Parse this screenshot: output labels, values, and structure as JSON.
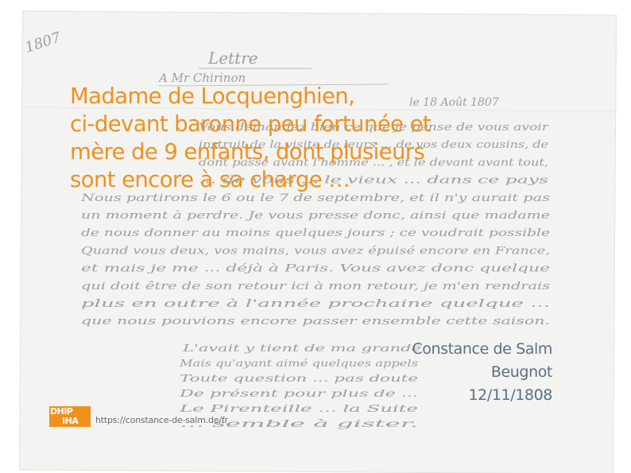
{
  "background_manuscript": {
    "year_marking": "1807",
    "heading_word": "Lettre",
    "addressee": "A Mr Chirinon",
    "date_line": "le 18 Août 1807",
    "lines": [
      "Vous demandez bien ce que je pense de vous avoir",
      "instruit de la visite de leurs ... de vos deux cousins, de",
      "dont passé avant l'homme ... , et le devant avant tout,",
      "... de vous ... le vieux ... dans ce pays",
      "Nous partirons le 6 ou le 7 de septembre, et il n'y aurait pas",
      "un moment à perdre. Je vous presse donc, ainsi que madame",
      "de nous donner au moins quelques jours ; ce voudrait possible",
      "Quand vous deux, vos mains, vous avez épuisé encore en France,",
      "et mais je me ... déjà à Paris. Vous avez donc quelque",
      "qui doit être de son retour ici à mon retour, je m'en rendrais",
      "plus en outre à l'année prochaine quelque ... ",
      "que nous pouvions encore passer ensemble cette saison."
    ],
    "verse_lines": [
      "L'avait y tient de ma grande",
      "Mais qu'ayant aimé quelques appels",
      "Toute question ... pas doute",
      "De présent pour plus de ...",
      "Le Pirenteille ... la Suite",
      "... semble à gister."
    ]
  },
  "quote": {
    "line1": " Madame de Locquenghien,",
    "line2": "ci-devant baronne peu fortunée et",
    "line3": "mère de 9 enfants, dont plusieurs",
    "line4": "sont encore à sa charge …"
  },
  "caption": {
    "author": "Constance de Salm",
    "recipient": "Beugnot",
    "date": "12/11/1808"
  },
  "footer": {
    "logo_line1": "DHIP",
    "logo_line2": "IHA",
    "url": "https://constance-de-salm.de/fr"
  },
  "colors": {
    "accent": "#f0911e",
    "caption": "#5c7080",
    "ink": "#9e9e9e",
    "paper": "#f3f3f2"
  }
}
